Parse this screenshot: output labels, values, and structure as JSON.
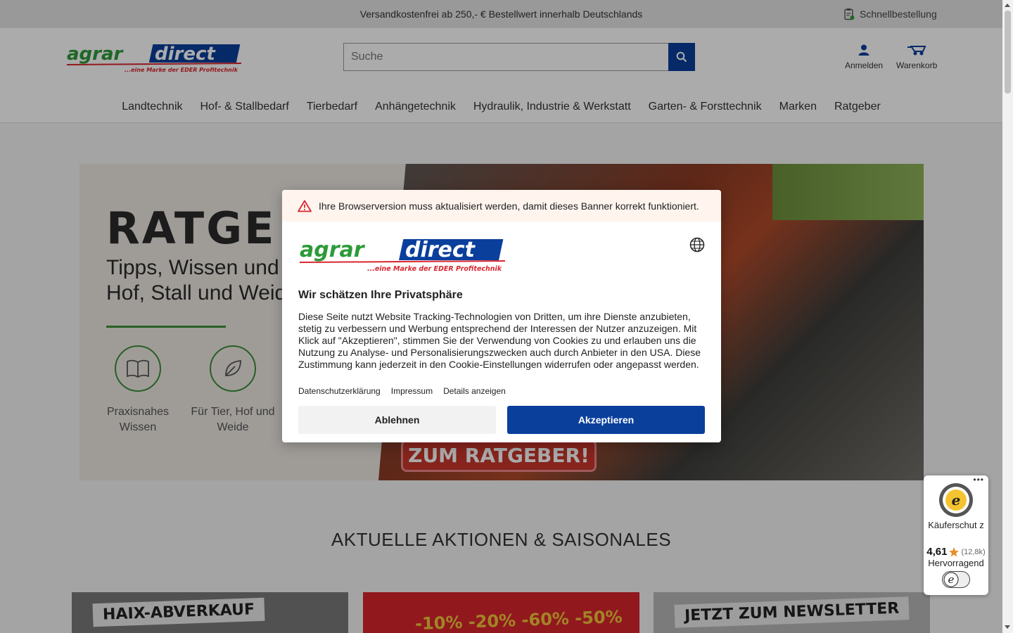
{
  "topbar": {
    "shipping_text": "Versandkostenfrei ab 250,- € Bestellwert innerhalb Deutschlands",
    "quick_order": "Schnellbestellung"
  },
  "brand": {
    "name_left": "agrar",
    "name_right": "direct",
    "tagline": "...eine Marke der EDER Profitechnik",
    "colors": {
      "green": "#2d9a3a",
      "blue": "#0a3f9c",
      "red": "#d8262e"
    }
  },
  "search": {
    "placeholder": "Suche",
    "icon": "search-icon"
  },
  "header_actions": {
    "login": "Anmelden",
    "cart": "Warenkorb"
  },
  "nav": {
    "items": [
      "Landtechnik",
      "Hof- & Stallbedarf",
      "Tierbedarf",
      "Anhängetechnik",
      "Hydraulik, Industrie & Werkstatt",
      "Garten- & Forsttechnik",
      "Marken",
      "Ratgeber"
    ]
  },
  "hero": {
    "title": "RATGE",
    "subtitle": "Tipps, Wissen und Hof, Stall und Weide",
    "features": [
      {
        "label": "Praxisnahes Wissen",
        "icon": "book-icon"
      },
      {
        "label": "Für Tier, Hof und Weide",
        "icon": "leaf-icon"
      }
    ],
    "cta": "ZUM RATGEBER!"
  },
  "section": {
    "title": "AKTUELLE AKTIONEN & SAISONALES"
  },
  "promos": [
    {
      "label": "HAIX-ABVERKAUF"
    },
    {
      "label": "-10% -20% -60% -50%"
    },
    {
      "label": "JETZT ZUM NEWSLETTER"
    }
  ],
  "cookie_dialog": {
    "warning": "Ihre Browserversion muss aktualisiert werden, damit dieses Banner korrekt funktioniert.",
    "title": "Wir schätzen Ihre Privatsphäre",
    "body": "Diese Seite nutzt Website Tracking-Technologien von Dritten, um ihre Dienste anzubieten, stetig zu verbessern und Werbung entsprechend der Interessen der Nutzer anzuzeigen. Mit Klick auf \"Akzeptieren\", stimmen Sie der Verwendung von Cookies zu und erlauben uns die Nutzung zu Analyse- und Personalisierungszwecken auch durch Anbieter in den USA. Diese Zustimmung kann jederzeit in den Cookie-Einstellungen widerrufen oder angepasst werden.",
    "links": [
      "Datenschutzerklärung",
      "Impressum",
      "Details anzeigen"
    ],
    "decline": "Ablehnen",
    "accept": "Akzeptieren"
  },
  "trusted_shops": {
    "label": "Käuferschut z",
    "score": "4,61",
    "count": "(12,8k)",
    "grade": "Hervorragend",
    "star_color": "#e58f2a"
  }
}
